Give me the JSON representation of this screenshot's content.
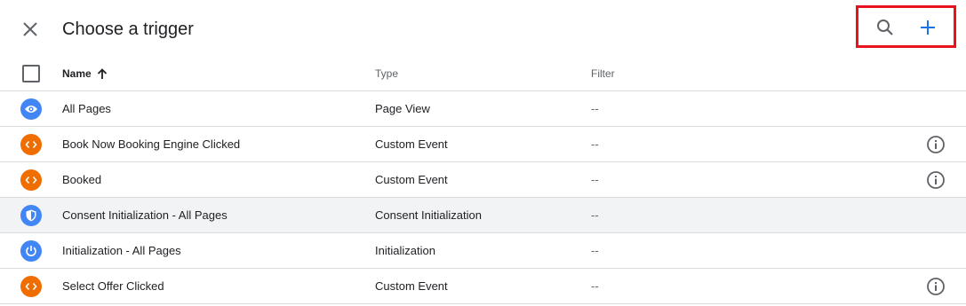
{
  "header": {
    "title": "Choose a trigger",
    "accent_color": "#1a73e8",
    "highlight_color": "#e8121f"
  },
  "table": {
    "columns": {
      "name": "Name",
      "type": "Type",
      "filter": "Filter"
    },
    "rows": [
      {
        "icon": "eye-icon",
        "icon_color": "#4285f4",
        "name": "All Pages",
        "type": "Page View",
        "filter": "--",
        "info": false
      },
      {
        "icon": "code-icon",
        "icon_color": "#f06d00",
        "name": "Book Now Booking Engine Clicked",
        "type": "Custom Event",
        "filter": "--",
        "info": true
      },
      {
        "icon": "code-icon",
        "icon_color": "#f06d00",
        "name": "Booked",
        "type": "Custom Event",
        "filter": "--",
        "info": true
      },
      {
        "icon": "shield-icon",
        "icon_color": "#4285f4",
        "name": "Consent Initialization - All Pages",
        "type": "Consent Initialization",
        "filter": "--",
        "info": false
      },
      {
        "icon": "power-icon",
        "icon_color": "#4285f4",
        "name": "Initialization - All Pages",
        "type": "Initialization",
        "filter": "--",
        "info": false
      },
      {
        "icon": "code-icon",
        "icon_color": "#f06d00",
        "name": "Select Offer Clicked",
        "type": "Custom Event",
        "filter": "--",
        "info": true
      }
    ]
  }
}
